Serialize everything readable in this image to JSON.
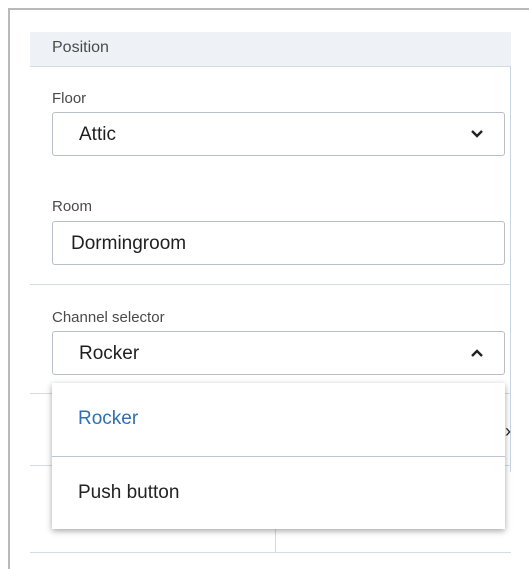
{
  "section": {
    "title": "Position"
  },
  "floor": {
    "label": "Floor",
    "value": "Attic",
    "icon": "chevron-down-icon"
  },
  "room": {
    "label": "Room",
    "value": "Dormingroom"
  },
  "channel": {
    "label": "Channel selector",
    "value": "Rocker",
    "icon": "chevron-up-icon",
    "options": [
      {
        "label": "Rocker",
        "selected": true
      },
      {
        "label": "Push button",
        "selected": false
      }
    ]
  },
  "colors": {
    "accent": "#2f6fb3",
    "header_bg": "#eef2f7",
    "border": "#b8bec6"
  }
}
